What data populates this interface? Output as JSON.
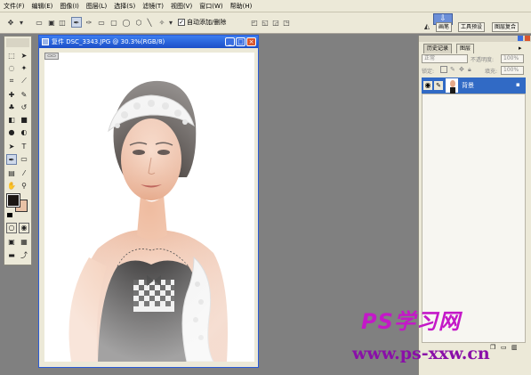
{
  "menu": [
    "文件(F)",
    "编辑(E)",
    "图像(I)",
    "图层(L)",
    "选择(S)",
    "滤镜(T)",
    "视图(V)",
    "窗口(W)",
    "帮助(H)"
  ],
  "options_bar": {
    "auto_select_label": "自动添加/删除",
    "auto_select_checked": true
  },
  "top_right_tabs": [
    "画笔",
    "工具预设",
    "图层复合"
  ],
  "document": {
    "title": "复件 DSC_3343.JPG @ 30.3%(RGB/8)",
    "minimize": "_",
    "maximize": "□",
    "close": "×"
  },
  "layers_panel": {
    "tabs": [
      "历史记录",
      "图层"
    ],
    "active_tab": "图层",
    "blend_mode": "正常",
    "opacity_label": "不透明度:",
    "opacity_value": "100%",
    "lock_label": "锁定:",
    "fill_label": "填充:",
    "fill_value": "100%",
    "layer_name": "背景"
  },
  "watermark": {
    "line1": "PS学习网",
    "line2": "www.ps-xxw.cn"
  },
  "icons": [
    "move-tool-icon",
    "marquee-icon",
    "lasso-icon",
    "magic-wand-icon",
    "crop-icon",
    "slice-icon",
    "healing-brush-icon",
    "brush-icon",
    "clone-stamp-icon",
    "history-brush-icon",
    "eraser-icon",
    "gradient-icon",
    "blur-icon",
    "dodge-icon",
    "path-selection-icon",
    "type-icon",
    "pen-icon",
    "shape-icon",
    "notes-icon",
    "eyedropper-icon",
    "hand-icon",
    "zoom-icon",
    "eye-icon",
    "lock-icon",
    "pin-icon"
  ],
  "colors": {
    "titlebar": "#1c4fc8",
    "selected_layer": "#316ac5",
    "workspace": "#808080",
    "chrome": "#ece9d8",
    "watermark_pink": "#c418c8"
  }
}
